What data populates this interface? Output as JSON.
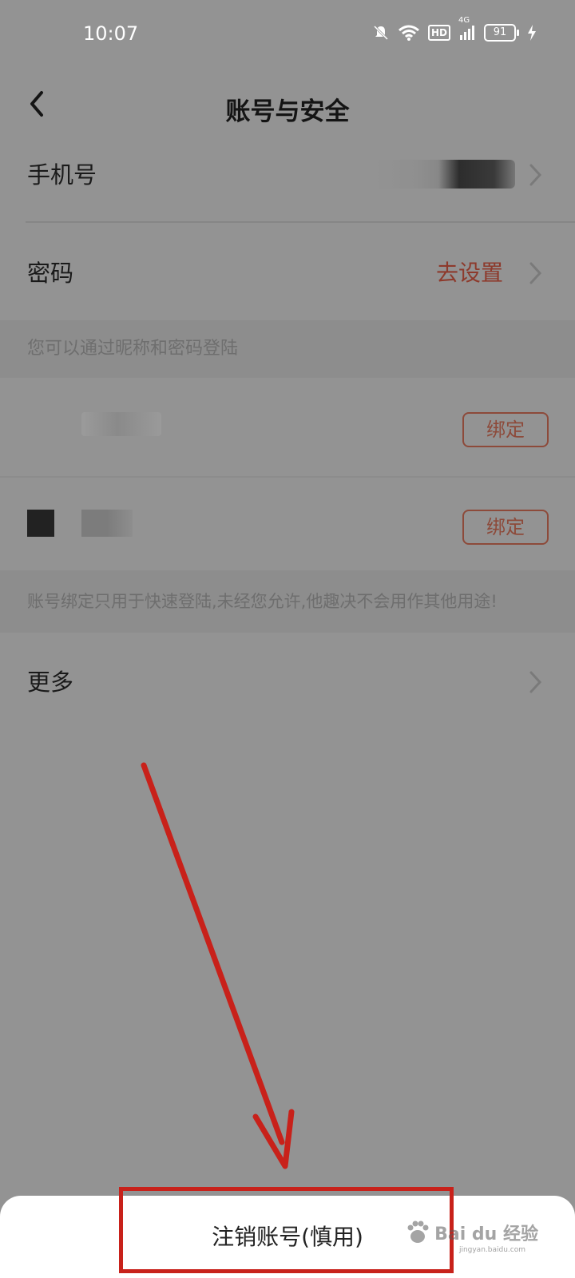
{
  "status_bar": {
    "time": "10:07",
    "hd_label": "HD",
    "network_label": "4G",
    "battery_level": "91"
  },
  "header": {
    "title": "账号与安全"
  },
  "rows": {
    "phone_label": "手机号",
    "password_label": "密码",
    "password_action": "去设置",
    "more_label": "更多"
  },
  "notes": {
    "nickname_login": "您可以通过昵称和密码登陆",
    "binding_notice": "账号绑定只用于快速登陆,未经您允许,他趣决不会用作其他用途!"
  },
  "bindings": [
    {
      "button_label": "绑定"
    },
    {
      "button_label": "绑定"
    }
  ],
  "bottom_sheet": {
    "delete_account_label": "注销账号(慎用)"
  },
  "watermark": {
    "text": "Bai du 经验",
    "sub": "jingyan.baidu.com"
  },
  "colors": {
    "accent": "#8d3a2c",
    "annotation_red": "#c8211a",
    "overlay_bg": "#939393"
  }
}
